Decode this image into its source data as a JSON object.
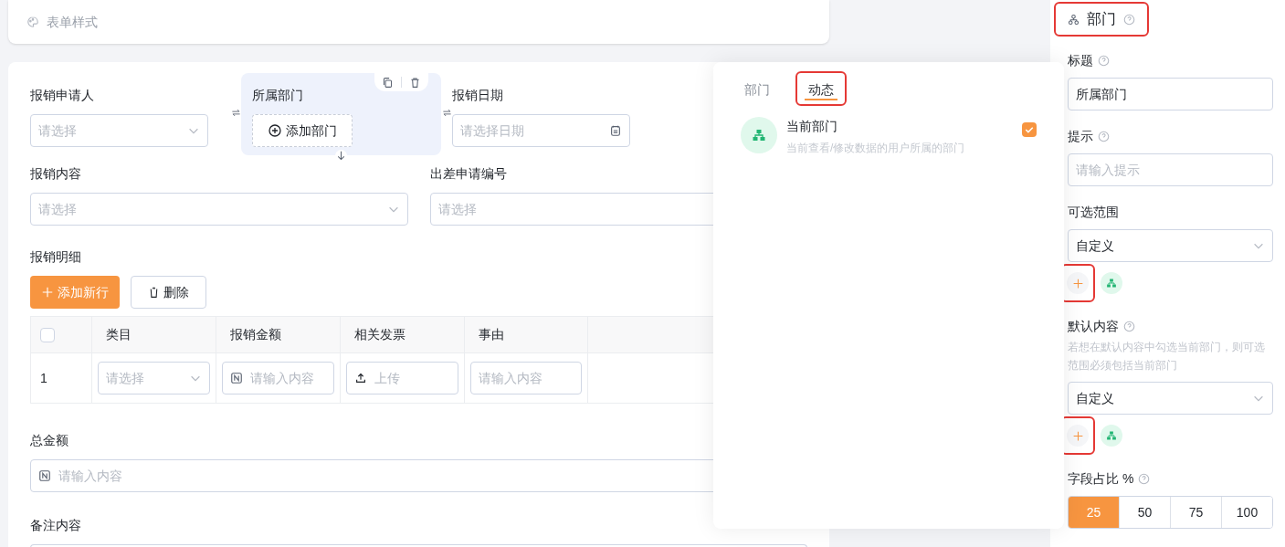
{
  "style_card": {
    "title": "表单样式"
  },
  "form": {
    "row1": [
      {
        "kind": "select",
        "label": "报销申请人",
        "placeholder": "请选择",
        "selected": false
      },
      {
        "kind": "department",
        "label": "所属部门",
        "button": "添加部门",
        "selected": true
      },
      {
        "kind": "date",
        "label": "报销日期",
        "placeholder": "请选择日期",
        "selected": false
      }
    ],
    "row2": [
      {
        "kind": "select",
        "label": "报销内容",
        "placeholder": "请选择"
      },
      {
        "kind": "text",
        "label": "出差申请编号",
        "placeholder": "请选择"
      }
    ],
    "details": {
      "label": "报销明细",
      "add_button": "添加新行",
      "delete_button": "删除",
      "columns": [
        {
          "kind": "check",
          "checked": false
        },
        {
          "kind": "text",
          "label": "类目"
        },
        {
          "kind": "text",
          "label": "报销金额"
        },
        {
          "kind": "text",
          "label": "相关发票"
        },
        {
          "kind": "text",
          "label": "事由"
        }
      ],
      "rows": [
        {
          "cells": [
            {
              "kind": "index",
              "text": "1"
            },
            {
              "kind": "select",
              "placeholder": "请选择"
            },
            {
              "kind": "number",
              "placeholder": "请输入内容"
            },
            {
              "kind": "upload",
              "placeholder": "上传"
            },
            {
              "kind": "text",
              "placeholder": "请输入内容"
            }
          ]
        }
      ]
    },
    "total": {
      "label": "总金额",
      "placeholder": "请输入内容"
    },
    "remark": {
      "label": "备注内容"
    }
  },
  "popover": {
    "tabs": [
      {
        "label": "部门",
        "selected": false,
        "highlighted": false
      },
      {
        "label": "动态",
        "selected": true,
        "highlighted": true
      }
    ],
    "items": [
      {
        "title": "当前部门",
        "description": "当前查看/修改数据的用户所属的部门",
        "checked": true
      }
    ]
  },
  "panel": {
    "title": "部门",
    "highlighted": true,
    "fields": [
      {
        "kind": "input",
        "label": "标题",
        "help": true,
        "value": "所属部门"
      },
      {
        "kind": "input",
        "label": "提示",
        "help": true,
        "placeholder": "请输入提示"
      },
      {
        "kind": "picker",
        "label": "可选范围",
        "help": false,
        "value": "自定义",
        "add_highlighted": true
      },
      {
        "kind": "picker",
        "label": "默认内容",
        "help": true,
        "note": "若想在默认内容中勾选当前部门，则可选范围必须包括当前部门",
        "value": "自定义",
        "add_highlighted": true
      },
      {
        "kind": "segments",
        "label": "字段占比 %",
        "help": true,
        "options": [
          {
            "label": "25",
            "selected": true
          },
          {
            "label": "50",
            "selected": false
          },
          {
            "label": "75",
            "selected": false
          },
          {
            "label": "100",
            "selected": false
          }
        ]
      }
    ]
  }
}
